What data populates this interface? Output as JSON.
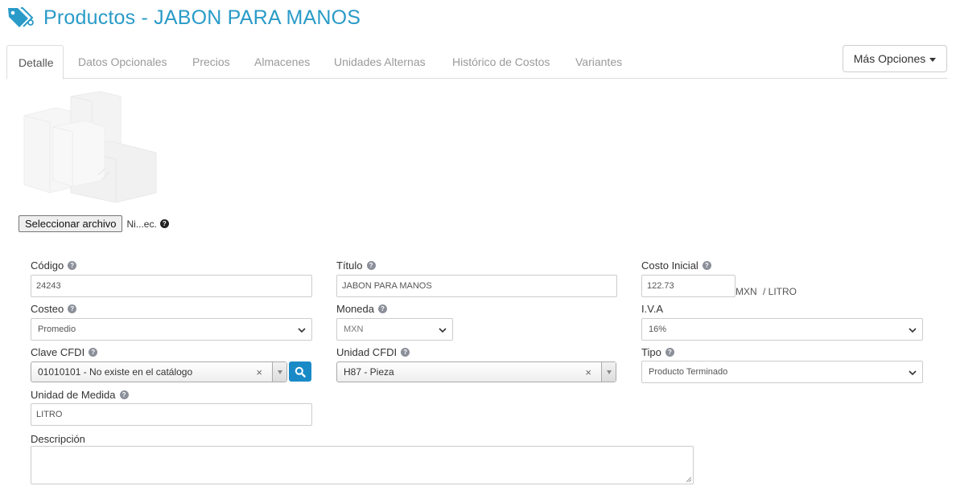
{
  "header": {
    "title": "Productos - JABON PARA MANOS",
    "icon": "tag-icon"
  },
  "tabs": [
    {
      "label": "Detalle",
      "active": true
    },
    {
      "label": "Datos Opcionales"
    },
    {
      "label": "Precios"
    },
    {
      "label": "Almacenes"
    },
    {
      "label": "Unidades Alternas"
    },
    {
      "label": "Histórico de Costos"
    },
    {
      "label": "Variantes"
    }
  ],
  "more_options": {
    "label": "Más Opciones"
  },
  "file": {
    "button_label": "Seleccionar archivo",
    "status": "Ni...ec."
  },
  "form": {
    "codigo": {
      "label": "Código",
      "value": "24243"
    },
    "titulo": {
      "label": "Título",
      "value": "JABON PARA MANOS"
    },
    "costo_inicial": {
      "label": "Costo Inicial",
      "value": "122.73",
      "currency": "MXN",
      "unit": "/ LITRO"
    },
    "costeo": {
      "label": "Costeo",
      "value": "Promedio"
    },
    "moneda": {
      "label": "Moneda",
      "value": "MXN"
    },
    "iva": {
      "label": "I.V.A",
      "value": "16%"
    },
    "clave_cfdi": {
      "label": "Clave CFDI",
      "value": "01010101 - No existe en el catálogo",
      "clear": "×"
    },
    "unidad_cfdi": {
      "label": "Unidad CFDI",
      "value": "H87 - Pieza",
      "clear": "×"
    },
    "tipo": {
      "label": "Tipo",
      "value": "Producto Terminado"
    },
    "unidad_medida": {
      "label": "Unidad de Medida",
      "value": "LITRO"
    },
    "descripcion": {
      "label": "Descripción",
      "value": ""
    }
  },
  "colors": {
    "title": "#2a9bc8",
    "search_button": "#1a8ac7"
  }
}
